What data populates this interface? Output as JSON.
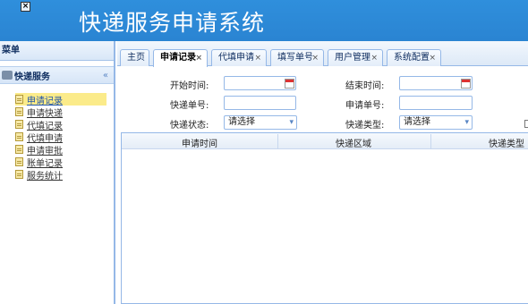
{
  "header": {
    "close_glyph": "×",
    "title": "快递服务申请系统"
  },
  "sidebar": {
    "title": "菜单",
    "group_label": "快递服务",
    "collapse_glyph": "«",
    "items": [
      {
        "label": "申请记录",
        "active": true
      },
      {
        "label": "申请快递"
      },
      {
        "label": "代填记录"
      },
      {
        "label": "代填申请"
      },
      {
        "label": "申请审批"
      },
      {
        "label": "账单记录"
      },
      {
        "label": "服务统计"
      }
    ]
  },
  "tabs": [
    {
      "label": "主页",
      "closable": false
    },
    {
      "label": "申请记录",
      "closable": true,
      "selected": true
    },
    {
      "label": "代填申请",
      "closable": true
    },
    {
      "label": "填写单号",
      "closable": true
    },
    {
      "label": "用户管理",
      "closable": true
    },
    {
      "label": "系统配置",
      "closable": true
    }
  ],
  "tab_close_glyph": "×",
  "form": {
    "start_time_label": "开始时间:",
    "end_time_label": "结束时间:",
    "express_no_label": "快递单号:",
    "apply_no_label": "申请单号:",
    "express_status_label": "快递状态:",
    "express_status_value": "请选择",
    "express_type_label": "快递类型:",
    "express_type_value": "请选择",
    "dropdown_glyph": "▾"
  },
  "grid": {
    "columns": [
      "申请时间",
      "快递区域",
      "快递类型"
    ]
  }
}
